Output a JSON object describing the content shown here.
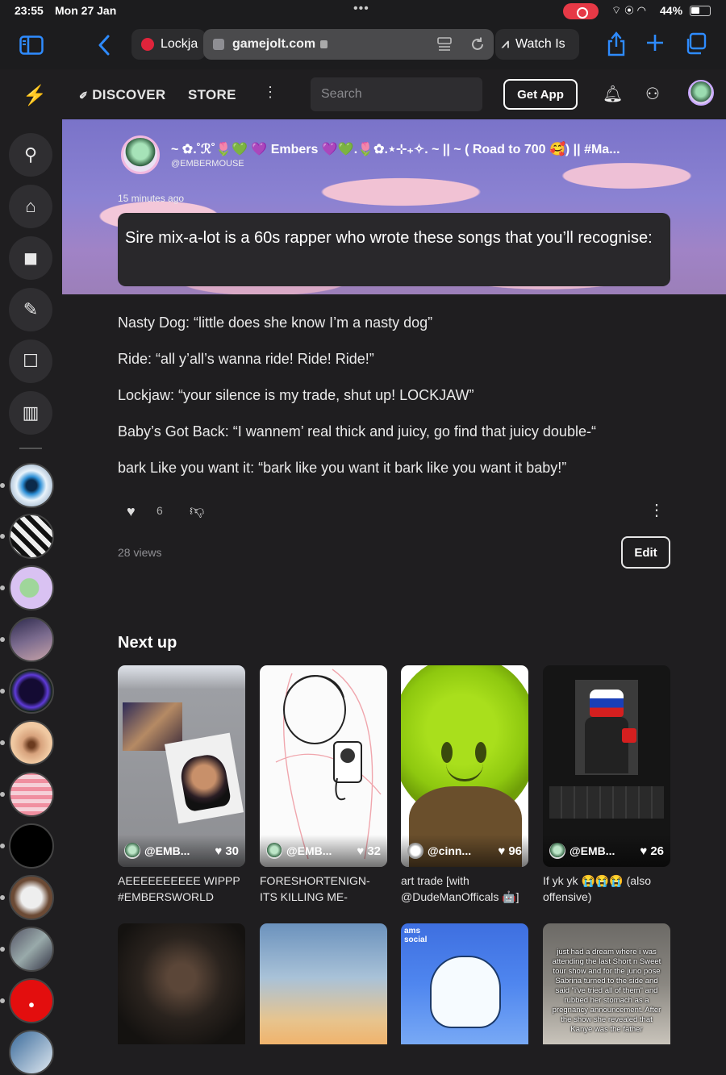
{
  "status_bar": {
    "time": "23:55",
    "date": "Mon 27 Jan",
    "battery": "44%"
  },
  "browser": {
    "tabs": [
      {
        "label": "Lockja"
      },
      {
        "label": "gamejolt.com"
      },
      {
        "label": "Watch Is"
      }
    ]
  },
  "header": {
    "discover": "DISCOVER",
    "store": "STORE",
    "search_placeholder": "Search",
    "get_app": "Get App"
  },
  "post": {
    "author": "~ ✿.˚ℛ˚🌷💚 💜 Embers 💜💚.🌷✿.⋆⊹₊✧. ~ || ~ ( Road to 700 🥰) || #Ma...",
    "handle": "@EMBERMOUSE",
    "time": "15 minutes ago",
    "lead": "Sire mix-a-lot is a 60s rapper who wrote these songs that you’ll recognise:",
    "lines": [
      "Nasty Dog: “little does she know I’m a nasty dog”",
      "Ride: “all y’all’s wanna ride! Ride! Ride!”",
      "Lockjaw: “your silence is my trade, shut up! LOCKJAW”",
      "Baby’s Got Back: “I wannem’ real thick and juicy, go find that juicy double-“",
      "bark Like you want it: “bark like you want it bark like you want it baby!”"
    ],
    "likes": "6",
    "views": "28 views",
    "edit": "Edit"
  },
  "next_up": {
    "title": "Next up",
    "cards": [
      {
        "user": "@EMB...",
        "likes": "30",
        "caption": "AEEEEEEEEEE WIPPP #EMBERSWORLD"
      },
      {
        "user": "@EMB...",
        "likes": "32",
        "caption": "FORESHORTENIGN- ITS KILLING ME-"
      },
      {
        "user": "@cinn...",
        "likes": "96",
        "caption": "art trade [with @DudeManOfficals 🤖]"
      },
      {
        "user": "@EMB...",
        "likes": "26",
        "caption": "If yk yk 😭😭😭 (also offensive)"
      }
    ]
  },
  "thumb_text": {
    "card3_top": "ams\nsocial",
    "card4": "just had a dream where i was attending the last Short n Sweet tour show and for the juno pose Sabrina turned to the side and said \"i've tried all of them\" and rubbed her stomach as a pregnancy announcement. After the show she revealed that Kanye was the father"
  },
  "icons": [
    "sidebar-icon",
    "back-icon",
    "share-icon",
    "plus-icon",
    "tabs-icon",
    "bolt-icon",
    "bell-icon",
    "people-icon",
    "heart-icon",
    "dislike-icon",
    "more-icon"
  ]
}
